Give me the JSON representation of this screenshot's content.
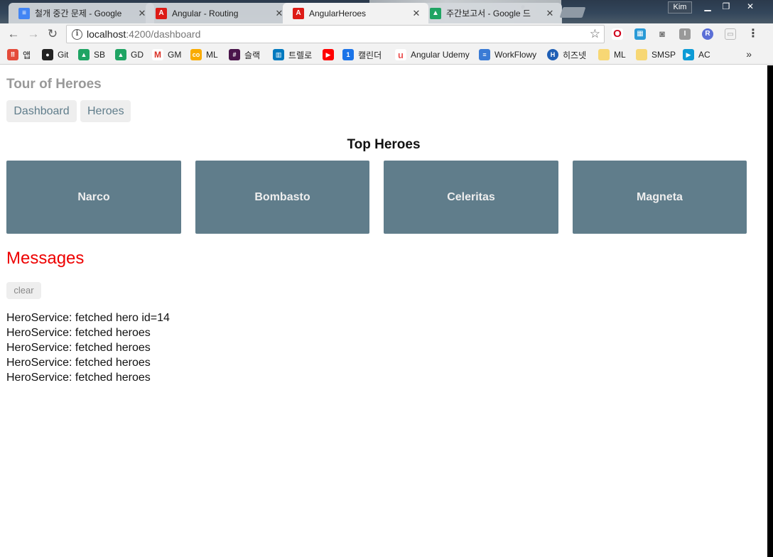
{
  "browser": {
    "tabs": [
      {
        "title": "철개 중간 문제 - Google",
        "favicon": "google-docs-icon",
        "active": false
      },
      {
        "title": "Angular - Routing",
        "favicon": "angular-icon",
        "active": false
      },
      {
        "title": "AngularHeroes",
        "favicon": "angular-icon",
        "active": true
      },
      {
        "title": "주간보고서 - Google 드",
        "favicon": "google-drive-icon",
        "active": false
      }
    ],
    "user": "Kim",
    "address": {
      "host": "localhost",
      "path": ":4200/dashboard"
    },
    "bookmarks": [
      {
        "label": "앱",
        "icon": "apps-grid-icon",
        "color": "#e44b3a"
      },
      {
        "label": "Git",
        "icon": "github-icon",
        "color": "#222222"
      },
      {
        "label": "SB",
        "icon": "google-drive-icon",
        "color": "#1fa463"
      },
      {
        "label": "GD",
        "icon": "google-drive-icon",
        "color": "#1fa463"
      },
      {
        "label": "GM",
        "icon": "gmail-icon",
        "color": "#d93025"
      },
      {
        "label": "ML",
        "icon": "colab-icon",
        "color": "#f9ab00"
      },
      {
        "label": "슬랙",
        "icon": "slack-icon",
        "color": "#4a154b"
      },
      {
        "label": "트렐로",
        "icon": "trello-icon",
        "color": "#0079bf"
      },
      {
        "label": "",
        "icon": "youtube-icon",
        "color": "#ff0000"
      },
      {
        "label": "캘린더",
        "icon": "calendar-icon",
        "color": "#1a73e8"
      },
      {
        "label": "Angular Udemy",
        "icon": "udemy-icon",
        "color": "#ec5252"
      },
      {
        "label": "WorkFlowy",
        "icon": "workflowy-icon",
        "color": "#3a7bd5"
      },
      {
        "label": "히즈넷",
        "icon": "hiznet-icon",
        "color": "#1f5fb5"
      },
      {
        "label": "ML",
        "icon": "folder-icon",
        "color": "#f7d774"
      },
      {
        "label": "SMSP",
        "icon": "folder-icon",
        "color": "#f7d774"
      },
      {
        "label": "AC",
        "icon": "ac-icon",
        "color": "#0c9bd6"
      }
    ],
    "more_bookmarks": "»"
  },
  "app": {
    "title": "Tour of Heroes",
    "nav": {
      "dashboard": "Dashboard",
      "heroes": "Heroes"
    },
    "top_heroes_heading": "Top Heroes",
    "heroes": [
      "Narco",
      "Bombasto",
      "Celeritas",
      "Magneta"
    ],
    "messages_heading": "Messages",
    "clear_label": "clear",
    "messages": [
      "HeroService: fetched hero id=14",
      "HeroService: fetched heroes",
      "HeroService: fetched heroes",
      "HeroService: fetched heroes",
      "HeroService: fetched heroes"
    ]
  },
  "colors": {
    "hero_card": "#607d8b",
    "nav_text": "#607d8b",
    "messages_heading": "#ee0000"
  }
}
